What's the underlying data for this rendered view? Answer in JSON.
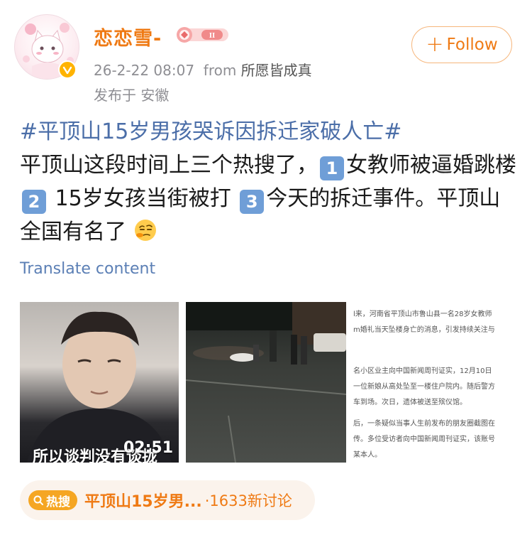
{
  "user": {
    "name": "恋恋雪-",
    "badge_icon": "level-badge-icon",
    "verified_icon": "verified-badge-icon"
  },
  "post": {
    "date": "26-2-22 08:07",
    "from_label": "from",
    "source": "所愿皆成真",
    "location": "发布于 安徽",
    "hashtag": "#平顶山15岁男孩哭诉因拆迁家破人亡#",
    "text_1": "平顶山这段时间上三个热搜了，",
    "num_1": "1",
    "text_2": "女教师被逼婚跳楼",
    "num_2": "2",
    "text_3": "15岁女孩当街被打",
    "num_3": "3",
    "text_4": "今天的拆迁事件。平顶山全国有名了",
    "emoji": "thinking-face-emoji"
  },
  "follow": {
    "label": "Follow"
  },
  "translate": {
    "label": "Translate content"
  },
  "media": {
    "video_duration": "02:51",
    "video_subtitle": "所以谈判没有谈拢",
    "doc_lines": [
      "l来，河南省平顶山市鲁山县一名28岁女教师",
      "m婚礼当天坠楼身亡的消息，引发持续关注与",
      "",
      "名小区业主向中国新闻周刊证实，12月10日",
      "一位新娘从高处坠至一楼住户院内。随后警方",
      "车到场。次日，遗体被送至殡仪馆。",
      "",
      "后，一条疑似当事人生前发布的朋友圈截图在",
      "传。多位受访者向中国新闻周刊证实，该账号",
      "某本人。"
    ]
  },
  "hot_topic": {
    "tag": "热搜",
    "title": "平顶山15岁男...",
    "count": "·1633新讨论"
  },
  "colors": {
    "username": "#ef7a14",
    "hashtag": "#4b6ea8",
    "translate": "#5b7fb5",
    "follow_border": "#f6b67c"
  }
}
